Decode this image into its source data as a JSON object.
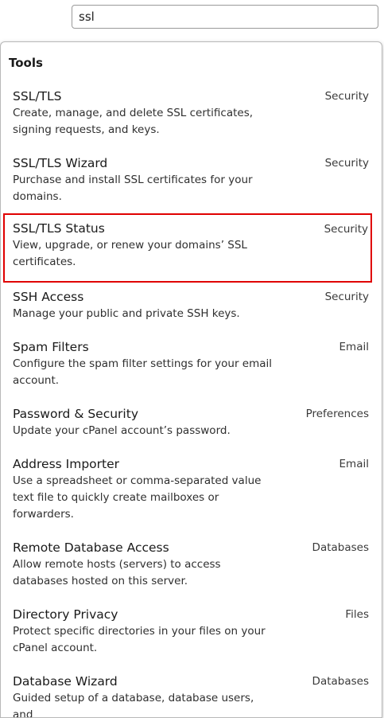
{
  "search": {
    "value": "ssl"
  },
  "panel": {
    "heading": "Tools"
  },
  "results": [
    {
      "title": "SSL/TLS",
      "description": "Create, manage, and delete SSL certificates, signing requests, and keys.",
      "category": "Security",
      "highlighted": false
    },
    {
      "title": "SSL/TLS Wizard",
      "description": "Purchase and install SSL certificates for your domains.",
      "category": "Security",
      "highlighted": false
    },
    {
      "title": "SSL/TLS Status",
      "description": "View, upgrade, or renew your domains’ SSL certificates.",
      "category": "Security",
      "highlighted": true
    },
    {
      "title": "SSH Access",
      "description": "Manage your public and private SSH keys.",
      "category": "Security",
      "highlighted": false
    },
    {
      "title": "Spam Filters",
      "description": "Configure the spam filter settings for your email account.",
      "category": "Email",
      "highlighted": false
    },
    {
      "title": "Password & Security",
      "description": "Update your cPanel account’s password.",
      "category": "Preferences",
      "highlighted": false
    },
    {
      "title": "Address Importer",
      "description": "Use a spreadsheet or comma-separated value text file to quickly create mailboxes or forwarders.",
      "category": "Email",
      "highlighted": false
    },
    {
      "title": "Remote Database Access",
      "description": "Allow remote hosts (servers) to access databases hosted on this server.",
      "category": "Databases",
      "highlighted": false
    },
    {
      "title": "Directory Privacy",
      "description": "Protect specific directories in your files on your cPanel account.",
      "category": "Files",
      "highlighted": false
    },
    {
      "title": "Database Wizard",
      "description": "Guided setup of a database, database users, and",
      "category": "Databases",
      "highlighted": false
    }
  ]
}
